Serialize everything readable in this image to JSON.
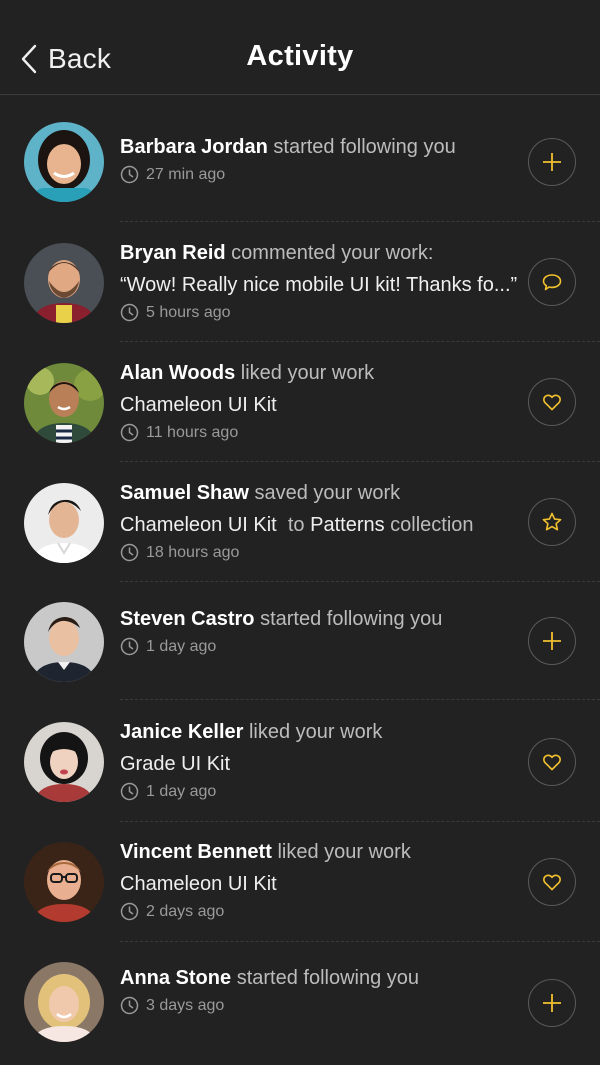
{
  "header": {
    "back_label": "Back",
    "title": "Activity"
  },
  "colors": {
    "background": "#222222",
    "accent": "#f2c12e",
    "text": "#ffffff",
    "muted": "#bcbcbc"
  },
  "activities": [
    {
      "name": "Barbara Jordan",
      "action_text": "started following you",
      "time": "27 min ago",
      "action_icon": "plus-icon"
    },
    {
      "name": "Bryan Reid",
      "action_text": "commented your work:",
      "detail": "“Wow! Really nice mobile UI kit! Thanks fo...”",
      "time": "5 hours ago",
      "action_icon": "comment-icon"
    },
    {
      "name": "Alan Woods",
      "action_text": "liked your work",
      "detail": "Chameleon UI Kit",
      "time": "11 hours ago",
      "action_icon": "heart-icon"
    },
    {
      "name": "Samuel Shaw",
      "action_text": "saved your work",
      "detail": "Chameleon UI Kit",
      "detail_to": "to",
      "detail_collection": "Patterns",
      "detail_suffix": "collection",
      "time": "18 hours ago",
      "action_icon": "star-icon"
    },
    {
      "name": "Steven Castro",
      "action_text": "started following you",
      "time": "1 day ago",
      "action_icon": "plus-icon"
    },
    {
      "name": "Janice Keller",
      "action_text": "liked your work",
      "detail": "Grade UI Kit",
      "time": "1 day ago",
      "action_icon": "heart-icon"
    },
    {
      "name": "Vincent Bennett",
      "action_text": "liked your work",
      "detail": "Chameleon UI Kit",
      "time": "2 days ago",
      "action_icon": "heart-icon"
    },
    {
      "name": "Anna Stone",
      "action_text": "started following you",
      "time": "3 days ago",
      "action_icon": "plus-icon"
    }
  ]
}
